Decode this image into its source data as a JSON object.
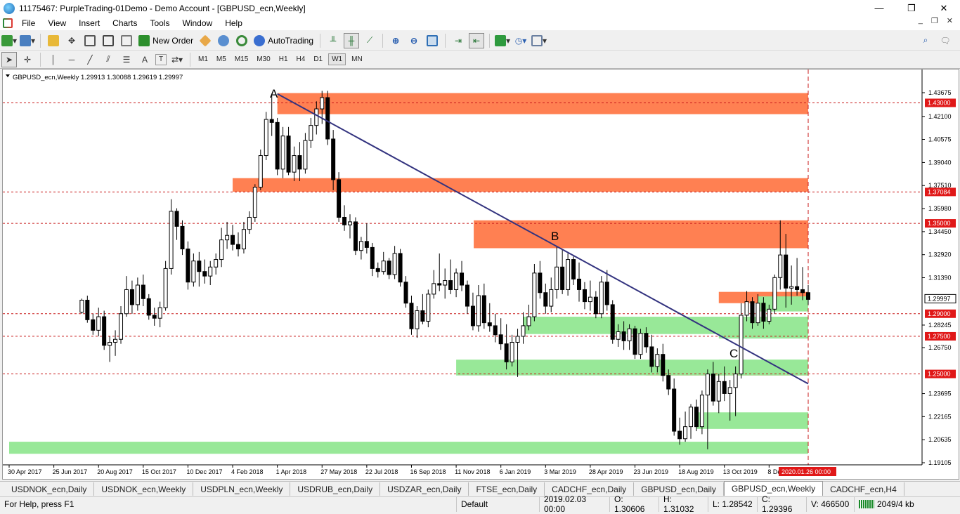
{
  "window": {
    "title": "11175467: PurpleTrading-01Demo - Demo Account - [GBPUSD_ecn,Weekly]",
    "min": "—",
    "max": "❐",
    "close": "✕"
  },
  "menu": [
    "File",
    "View",
    "Insert",
    "Charts",
    "Tools",
    "Window",
    "Help"
  ],
  "toolbar": {
    "new_order": "New Order",
    "autotrading": "AutoTrading"
  },
  "timeframes": [
    "M1",
    "M5",
    "M15",
    "M30",
    "H1",
    "H4",
    "D1",
    "W1",
    "MN"
  ],
  "active_timeframe": "W1",
  "chart": {
    "header": "GBPUSD_ecn,Weekly  1.29913 1.30088 1.29619 1.29997",
    "price_ticks": [
      "1.43675",
      "1.42100",
      "1.40575",
      "1.39040",
      "1.37510",
      "1.35980",
      "1.34450",
      "1.32920",
      "1.31390",
      "1.28245",
      "1.26750",
      "1.23695",
      "1.22165",
      "1.20635",
      "1.19105"
    ],
    "hlines": [
      {
        "price": 1.43,
        "label": "1.43000"
      },
      {
        "price": 1.37084,
        "label": "1.37084"
      },
      {
        "price": 1.35,
        "label": "1.35000"
      },
      {
        "price": 1.29,
        "label": "1.29000"
      },
      {
        "price": 1.275,
        "label": "1.27500"
      },
      {
        "price": 1.25,
        "label": "1.25000"
      }
    ],
    "current_price": {
      "price": 1.29997,
      "label": "1.29997"
    },
    "date_ticks": [
      "30 Apr 2017",
      "25 Jun 2017",
      "20 Aug 2017",
      "15 Oct 2017",
      "10 Dec 2017",
      "4 Feb 2018",
      "1 Apr 2018",
      "27 May 2018",
      "22 Jul 2018",
      "16 Sep 2018",
      "11 Nov 2018",
      "6 Jan 2019",
      "3 Mar 2019",
      "28 Apr 2019",
      "23 Jun 2019",
      "18 Aug 2019",
      "13 Oct 2019",
      "8 Dec 2019"
    ],
    "cursor_date": "2020.01.26 00:00",
    "annotations": [
      "A",
      "B",
      "C"
    ],
    "zones": [
      {
        "type": "supply",
        "color": "#ff8052",
        "from": "1 Apr 2018",
        "hi": 1.4365,
        "lo": 1.4225
      },
      {
        "type": "supply",
        "color": "#ff8052",
        "from": "4 Feb 2018",
        "hi": 1.38,
        "lo": 1.371
      },
      {
        "type": "supply",
        "color": "#ff8052",
        "from": "3 Dec 2018",
        "hi": 1.352,
        "lo": 1.3335
      },
      {
        "type": "supply",
        "color": "#ff8052",
        "from": "19 May 2019",
        "hi": 1.2875,
        "lo": 1.277
      },
      {
        "type": "supply",
        "color": "#ff8052",
        "from": "7 Jul 2019",
        "hi": 1.2585,
        "lo": 1.249
      },
      {
        "type": "supply",
        "color": "#ff8052",
        "from": "6 Oct 2019",
        "hi": 1.3045,
        "lo": 1.297
      },
      {
        "type": "demand",
        "color": "#98e898",
        "from": "3 Feb 2019",
        "hi": 1.288,
        "lo": 1.2765
      },
      {
        "type": "demand",
        "color": "#98e898",
        "from": "11 Nov 2018",
        "hi": 1.2595,
        "lo": 1.249
      },
      {
        "type": "demand",
        "color": "#98e898",
        "from": "6 Oct 2019",
        "hi": 1.2775,
        "lo": 1.2735
      },
      {
        "type": "demand",
        "color": "#98e898",
        "from": "6 Oct 2019",
        "hi": 1.2595,
        "lo": 1.2495
      },
      {
        "type": "demand",
        "color": "#98e898",
        "from": "8 Sep 2019",
        "hi": 1.2245,
        "lo": 1.2135
      },
      {
        "type": "demand",
        "color": "#98e898",
        "from": "24 Nov 2019",
        "hi": 1.3015,
        "lo": 1.2915
      },
      {
        "type": "demand",
        "color": "#98e898",
        "from": "30 Apr 2017",
        "hi": 1.205,
        "lo": 1.197
      }
    ],
    "trendline": {
      "color": "#33337f",
      "from": {
        "date": "1 Apr 2018",
        "price": 1.436
      },
      "to": {
        "date": "26 Jan 2020",
        "price": 1.2435
      }
    },
    "candles": [
      [
        1.291,
        1.3,
        1.29,
        1.299
      ],
      [
        1.299,
        1.302,
        1.284,
        1.286
      ],
      [
        1.286,
        1.29,
        1.276,
        1.279
      ],
      [
        1.279,
        1.294,
        1.275,
        1.288
      ],
      [
        1.288,
        1.292,
        1.266,
        1.269
      ],
      [
        1.269,
        1.275,
        1.258,
        1.271
      ],
      [
        1.271,
        1.279,
        1.262,
        1.273
      ],
      [
        1.273,
        1.295,
        1.27,
        1.29
      ],
      [
        1.29,
        1.315,
        1.288,
        1.306
      ],
      [
        1.306,
        1.312,
        1.29,
        1.296
      ],
      [
        1.296,
        1.314,
        1.292,
        1.309
      ],
      [
        1.309,
        1.316,
        1.295,
        1.3
      ],
      [
        1.3,
        1.303,
        1.286,
        1.289
      ],
      [
        1.289,
        1.294,
        1.282,
        1.287
      ],
      [
        1.287,
        1.298,
        1.281,
        1.294
      ],
      [
        1.294,
        1.325,
        1.292,
        1.32
      ],
      [
        1.32,
        1.366,
        1.316,
        1.358
      ],
      [
        1.358,
        1.36,
        1.339,
        1.348
      ],
      [
        1.348,
        1.352,
        1.329,
        1.333
      ],
      [
        1.333,
        1.338,
        1.306,
        1.311
      ],
      [
        1.311,
        1.33,
        1.308,
        1.325
      ],
      [
        1.325,
        1.331,
        1.308,
        1.318
      ],
      [
        1.318,
        1.326,
        1.31,
        1.315
      ],
      [
        1.315,
        1.325,
        1.309,
        1.321
      ],
      [
        1.321,
        1.33,
        1.316,
        1.326
      ],
      [
        1.326,
        1.347,
        1.321,
        1.339
      ],
      [
        1.339,
        1.351,
        1.333,
        1.342
      ],
      [
        1.342,
        1.349,
        1.332,
        1.336
      ],
      [
        1.336,
        1.344,
        1.328,
        1.333
      ],
      [
        1.333,
        1.351,
        1.33,
        1.346
      ],
      [
        1.346,
        1.358,
        1.343,
        1.354
      ],
      [
        1.354,
        1.376,
        1.351,
        1.374
      ],
      [
        1.374,
        1.399,
        1.372,
        1.395
      ],
      [
        1.395,
        1.424,
        1.392,
        1.419
      ],
      [
        1.419,
        1.436,
        1.408,
        1.417
      ],
      [
        1.417,
        1.42,
        1.382,
        1.386
      ],
      [
        1.386,
        1.414,
        1.38,
        1.408
      ],
      [
        1.408,
        1.414,
        1.382,
        1.384
      ],
      [
        1.384,
        1.401,
        1.378,
        1.395
      ],
      [
        1.395,
        1.404,
        1.378,
        1.386
      ],
      [
        1.386,
        1.41,
        1.383,
        1.405
      ],
      [
        1.405,
        1.42,
        1.4,
        1.415
      ],
      [
        1.415,
        1.431,
        1.409,
        1.426
      ],
      [
        1.426,
        1.438,
        1.416,
        1.4335
      ],
      [
        1.4335,
        1.438,
        1.402,
        1.406
      ],
      [
        1.406,
        1.412,
        1.372,
        1.379
      ],
      [
        1.379,
        1.384,
        1.351,
        1.354
      ],
      [
        1.354,
        1.362,
        1.345,
        1.349
      ],
      [
        1.349,
        1.356,
        1.34,
        1.351
      ],
      [
        1.351,
        1.354,
        1.329,
        1.332
      ],
      [
        1.332,
        1.341,
        1.326,
        1.338
      ],
      [
        1.338,
        1.35,
        1.33,
        1.334
      ],
      [
        1.334,
        1.337,
        1.315,
        1.32
      ],
      [
        1.32,
        1.324,
        1.314,
        1.318
      ],
      [
        1.318,
        1.331,
        1.316,
        1.325
      ],
      [
        1.325,
        1.327,
        1.313,
        1.316
      ],
      [
        1.316,
        1.335,
        1.313,
        1.33
      ],
      [
        1.33,
        1.333,
        1.308,
        1.311
      ],
      [
        1.311,
        1.315,
        1.294,
        1.297
      ],
      [
        1.297,
        1.302,
        1.276,
        1.28
      ],
      [
        1.28,
        1.295,
        1.274,
        1.292
      ],
      [
        1.292,
        1.303,
        1.283,
        1.285
      ],
      [
        1.285,
        1.306,
        1.281,
        1.303
      ],
      [
        1.303,
        1.319,
        1.3,
        1.31
      ],
      [
        1.31,
        1.33,
        1.305,
        1.309
      ],
      [
        1.309,
        1.32,
        1.3,
        1.312
      ],
      [
        1.312,
        1.326,
        1.303,
        1.306
      ],
      [
        1.306,
        1.32,
        1.301,
        1.317
      ],
      [
        1.317,
        1.325,
        1.305,
        1.309
      ],
      [
        1.309,
        1.312,
        1.29,
        1.295
      ],
      [
        1.295,
        1.304,
        1.279,
        1.282
      ],
      [
        1.282,
        1.309,
        1.278,
        1.302
      ],
      [
        1.302,
        1.31,
        1.28,
        1.284
      ],
      [
        1.284,
        1.297,
        1.278,
        1.282
      ],
      [
        1.282,
        1.29,
        1.271,
        1.276
      ],
      [
        1.276,
        1.287,
        1.266,
        1.27
      ],
      [
        1.27,
        1.283,
        1.253,
        1.258
      ],
      [
        1.258,
        1.276,
        1.255,
        1.271
      ],
      [
        1.271,
        1.28,
        1.248,
        1.275
      ],
      [
        1.275,
        1.291,
        1.27,
        1.282
      ],
      [
        1.282,
        1.296,
        1.279,
        1.288
      ],
      [
        1.288,
        1.323,
        1.285,
        1.317
      ],
      [
        1.317,
        1.325,
        1.3,
        1.304
      ],
      [
        1.304,
        1.31,
        1.29,
        1.295
      ],
      [
        1.295,
        1.314,
        1.291,
        1.306
      ],
      [
        1.306,
        1.335,
        1.3,
        1.321
      ],
      [
        1.321,
        1.333,
        1.303,
        1.306
      ],
      [
        1.306,
        1.33,
        1.302,
        1.326
      ],
      [
        1.326,
        1.328,
        1.309,
        1.313
      ],
      [
        1.313,
        1.324,
        1.298,
        1.306
      ],
      [
        1.306,
        1.311,
        1.293,
        1.298
      ],
      [
        1.298,
        1.312,
        1.292,
        1.301
      ],
      [
        1.301,
        1.305,
        1.287,
        1.29
      ],
      [
        1.29,
        1.315,
        1.287,
        1.311
      ],
      [
        1.311,
        1.319,
        1.292,
        1.296
      ],
      [
        1.296,
        1.299,
        1.27,
        1.273
      ],
      [
        1.273,
        1.283,
        1.268,
        1.278
      ],
      [
        1.278,
        1.285,
        1.266,
        1.272
      ],
      [
        1.272,
        1.283,
        1.266,
        1.28
      ],
      [
        1.28,
        1.282,
        1.26,
        1.263
      ],
      [
        1.263,
        1.28,
        1.26,
        1.277
      ],
      [
        1.277,
        1.281,
        1.264,
        1.268
      ],
      [
        1.268,
        1.276,
        1.251,
        1.255
      ],
      [
        1.255,
        1.267,
        1.251,
        1.263
      ],
      [
        1.263,
        1.27,
        1.245,
        1.249
      ],
      [
        1.249,
        1.253,
        1.236,
        1.24
      ],
      [
        1.24,
        1.247,
        1.209,
        1.212
      ],
      [
        1.212,
        1.221,
        1.203,
        1.207
      ],
      [
        1.207,
        1.225,
        1.205,
        1.215
      ],
      [
        1.215,
        1.23,
        1.207,
        1.228
      ],
      [
        1.228,
        1.233,
        1.212,
        1.215
      ],
      [
        1.215,
        1.239,
        1.21,
        1.236
      ],
      [
        1.236,
        1.253,
        1.2,
        1.25
      ],
      [
        1.25,
        1.258,
        1.229,
        1.232
      ],
      [
        1.232,
        1.25,
        1.224,
        1.245
      ],
      [
        1.245,
        1.255,
        1.232,
        1.237
      ],
      [
        1.237,
        1.246,
        1.219,
        1.241
      ],
      [
        1.241,
        1.255,
        1.222,
        1.25
      ],
      [
        1.25,
        1.297,
        1.247,
        1.289
      ],
      [
        1.289,
        1.305,
        1.285,
        1.298
      ],
      [
        1.298,
        1.301,
        1.28,
        1.284
      ],
      [
        1.284,
        1.303,
        1.282,
        1.297
      ],
      [
        1.297,
        1.301,
        1.28,
        1.285
      ],
      [
        1.285,
        1.296,
        1.283,
        1.293
      ],
      [
        1.293,
        1.316,
        1.29,
        1.314
      ],
      [
        1.314,
        1.352,
        1.306,
        1.329
      ],
      [
        1.329,
        1.343,
        1.294,
        1.307
      ],
      [
        1.307,
        1.322,
        1.296,
        1.308
      ],
      [
        1.308,
        1.327,
        1.302,
        1.306
      ],
      [
        1.306,
        1.321,
        1.299,
        1.304
      ],
      [
        1.304,
        1.309,
        1.296,
        1.2995
      ]
    ]
  },
  "tabs": [
    "USDNOK_ecn,Daily",
    "USDNOK_ecn,Weekly",
    "USDPLN_ecn,Weekly",
    "USDRUB_ecn,Daily",
    "USDZAR_ecn,Daily",
    "FTSE_ecn,Daily",
    "CADCHF_ecn,Daily",
    "GBPUSD_ecn,Daily",
    "GBPUSD_ecn,Weekly",
    "CADCHF_ecn,H4"
  ],
  "active_tab": "GBPUSD_ecn,Weekly",
  "status": {
    "help": "For Help, press F1",
    "profile": "Default",
    "datetime": "2019.02.03 00:00",
    "open": "O: 1.30606",
    "high": "H: 1.31032",
    "low": "L: 1.28542",
    "close": "C: 1.29396",
    "volume": "V: 466500",
    "traffic": "2049/4 kb"
  }
}
